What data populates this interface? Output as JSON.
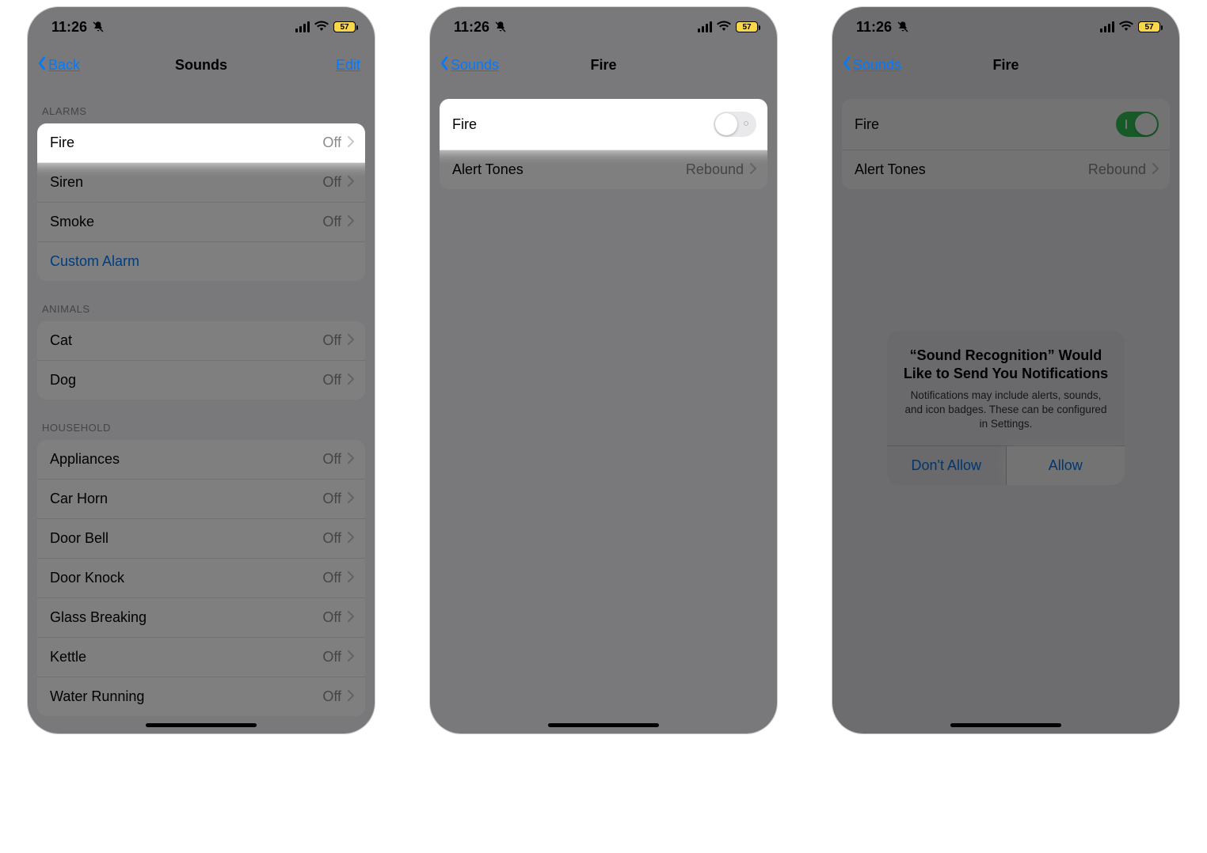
{
  "status": {
    "time": "11:26",
    "battery": "57"
  },
  "screen1": {
    "back": "Back",
    "title": "Sounds",
    "edit": "Edit",
    "sec_alarms": "Alarms",
    "sec_animals": "Animals",
    "sec_household": "Household",
    "off": "Off",
    "alarms": [
      {
        "label": "Fire"
      },
      {
        "label": "Siren"
      },
      {
        "label": "Smoke"
      }
    ],
    "custom": "Custom Alarm",
    "animals": [
      {
        "label": "Cat"
      },
      {
        "label": "Dog"
      }
    ],
    "household": [
      {
        "label": "Appliances"
      },
      {
        "label": "Car Horn"
      },
      {
        "label": "Door Bell"
      },
      {
        "label": "Door Knock"
      },
      {
        "label": "Glass Breaking"
      },
      {
        "label": "Kettle"
      },
      {
        "label": "Water Running"
      }
    ]
  },
  "screen2": {
    "back": "Sounds",
    "title": "Fire",
    "row_fire": "Fire",
    "row_alert": "Alert Tones",
    "alert_val": "Rebound"
  },
  "screen3": {
    "back": "Sounds",
    "title": "Fire",
    "row_fire": "Fire",
    "row_alert": "Alert Tones",
    "alert_val": "Rebound",
    "dialog_title": "“Sound Recognition” Would Like to Send You Notifications",
    "dialog_desc": "Notifications may include alerts, sounds, and icon badges. These can be configured in Settings.",
    "dont_allow": "Don't Allow",
    "allow": "Allow"
  }
}
